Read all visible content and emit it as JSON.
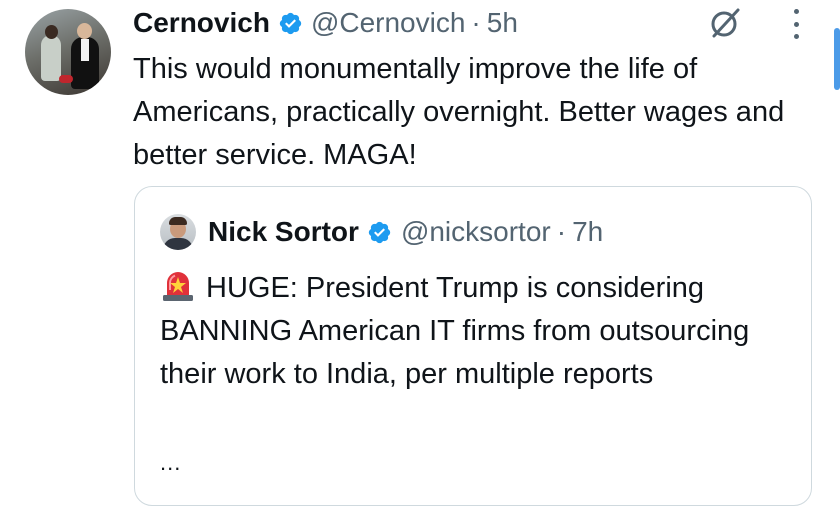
{
  "tweet": {
    "author_name": "Cernovich",
    "handle": "@Cernovich",
    "separator": "·",
    "time": "5h",
    "text": "This would monumentally improve the life of Americans, practically overnight. Better wages and better service. MAGA!",
    "verified_icon": "verified-badge-icon",
    "grok_icon": "grok-icon",
    "more_icon": "more-vertical-icon",
    "accent_color": "#1d9bf0"
  },
  "quoted_tweet": {
    "author_name": "Nick Sortor",
    "handle": "@nicksortor",
    "separator": "·",
    "time": "7h",
    "emoji_icon": "police-siren-icon",
    "text": "HUGE: President Trump is considering BANNING American IT firms from outsourcing their work to India, per multiple reports",
    "ellipsis": "..."
  }
}
